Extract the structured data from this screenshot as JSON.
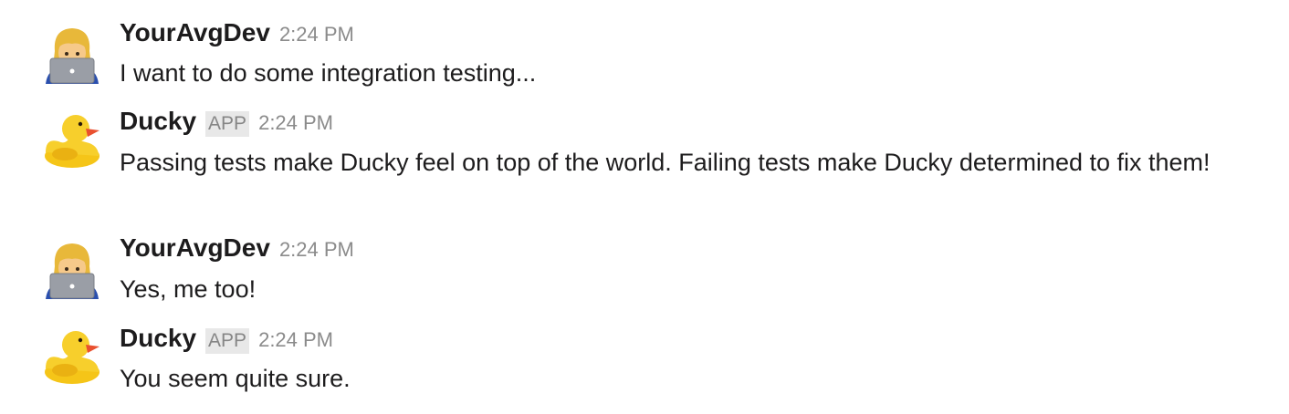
{
  "messages": [
    {
      "author": "YourAvgDev",
      "avatar_icon": "woman-technologist-emoji",
      "badge": "",
      "time": "2:24 PM",
      "text": "I want to do some integration testing..."
    },
    {
      "author": "Ducky",
      "avatar_icon": "rubber-duck-emoji",
      "badge": "APP",
      "time": "2:24 PM",
      "text": "Passing tests make Ducky feel on top of the world. Failing tests make Ducky determined to fix them!"
    },
    {
      "author": "YourAvgDev",
      "avatar_icon": "woman-technologist-emoji",
      "badge": "",
      "time": "2:24 PM",
      "text": "Yes, me too!"
    },
    {
      "author": "Ducky",
      "avatar_icon": "rubber-duck-emoji",
      "badge": "APP",
      "time": "2:24 PM",
      "text": "You seem quite sure."
    }
  ],
  "colors": {
    "name": "#1d1c1d",
    "time": "#8b8b8b",
    "badge_bg": "#e8e8e8",
    "badge_text": "#868686",
    "duck_yellow": "#f5c518",
    "duck_beak": "#e9502f"
  }
}
